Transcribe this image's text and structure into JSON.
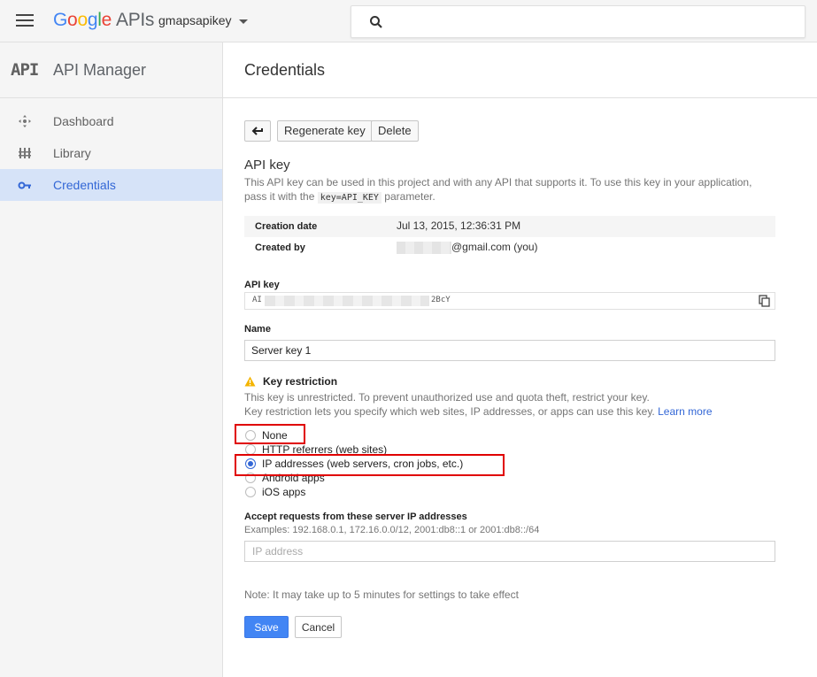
{
  "topbar": {
    "logo_google": [
      "G",
      "o",
      "o",
      "g",
      "l",
      "e"
    ],
    "logo_apis": "APIs",
    "project_name": "gmapsapikey"
  },
  "sidebar": {
    "logo_text": "API",
    "title": "API Manager",
    "items": [
      {
        "label": "Dashboard",
        "icon": "dashboard-icon"
      },
      {
        "label": "Library",
        "icon": "library-icon"
      },
      {
        "label": "Credentials",
        "icon": "key-icon",
        "active": true
      }
    ]
  },
  "page": {
    "title": "Credentials",
    "buttons": {
      "regenerate": "Regenerate key",
      "delete": "Delete"
    },
    "section_title": "API key",
    "description_1": "This API key can be used in this project and with any API that supports it. To use this key in your application,",
    "description_2a": "pass it with the",
    "description_code": "key=API_KEY",
    "description_2b": "parameter.",
    "info": {
      "creation_label": "Creation date",
      "creation_value": "Jul 13, 2015, 12:36:31 PM",
      "createdby_label": "Created by",
      "createdby_value": "@gmail.com (you)"
    },
    "apikey": {
      "label": "API key",
      "prefix": "AI",
      "suffix": "2BcY"
    },
    "name": {
      "label": "Name",
      "value": "Server key 1"
    },
    "restriction": {
      "title": "Key restriction",
      "desc_1": "This key is unrestricted. To prevent unauthorized use and quota theft, restrict your key.",
      "desc_2": "Key restriction lets you specify which web sites, IP addresses, or apps can use this key.",
      "learn_more": "Learn more",
      "options": [
        {
          "label": "None",
          "checked": false
        },
        {
          "label": "HTTP referrers (web sites)",
          "checked": false
        },
        {
          "label": "IP addresses (web servers, cron jobs, etc.)",
          "checked": true
        },
        {
          "label": "Android apps",
          "checked": false
        },
        {
          "label": "iOS apps",
          "checked": false
        }
      ]
    },
    "ip": {
      "label": "Accept requests from these server IP addresses",
      "examples": "Examples: 192.168.0.1, 172.16.0.0/12, 2001:db8::1 or 2001:db8::/64",
      "placeholder": "IP address"
    },
    "note": "Note: It may take up to 5 minutes for settings to take effect",
    "save": "Save",
    "cancel": "Cancel"
  },
  "colors": {
    "accent": "#3367d6",
    "highlight": "#e00000",
    "save_button": "#4285f4"
  }
}
